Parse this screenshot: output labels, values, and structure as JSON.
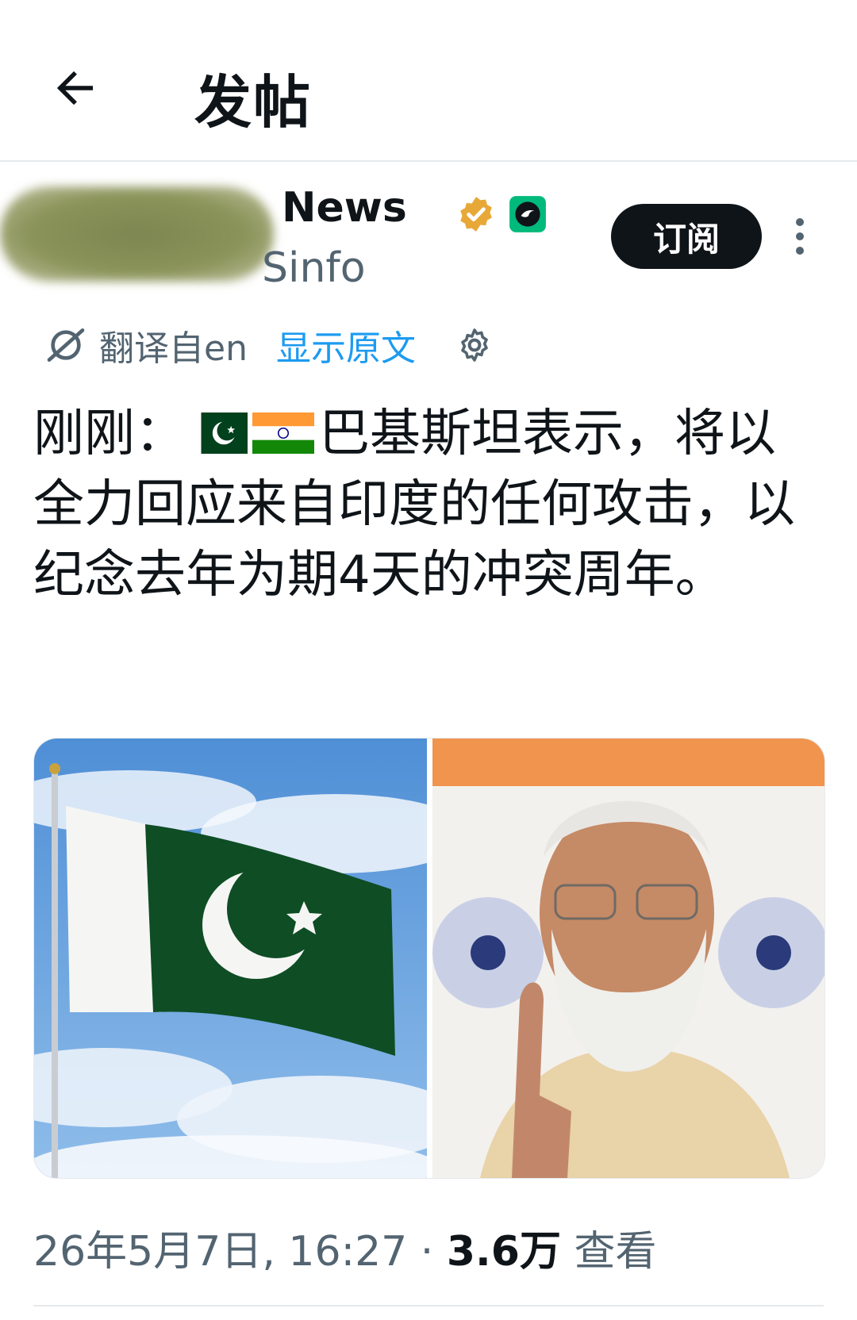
{
  "header": {
    "title": "发帖",
    "back_icon": "arrow-left-icon"
  },
  "author": {
    "name": "News",
    "handle": "Sinfo",
    "subscribe_label": "订阅",
    "verified_color": "#e8a838",
    "affiliate_color": "#00ba7c"
  },
  "translation": {
    "label": "翻译自en",
    "show_original": "显示原文"
  },
  "post": {
    "prefix": "刚刚：",
    "body": "巴基斯坦表示，将以全力回应来自印度的任何攻击，以纪念去年为期4天的冲突周年。"
  },
  "meta": {
    "timestamp": "26年5月7日, 16:27",
    "separator": " · ",
    "views_count": "3.6万",
    "views_label": " 查看"
  },
  "colors": {
    "link": "#1d9bf0",
    "muted": "#536471",
    "text": "#0f1419"
  }
}
